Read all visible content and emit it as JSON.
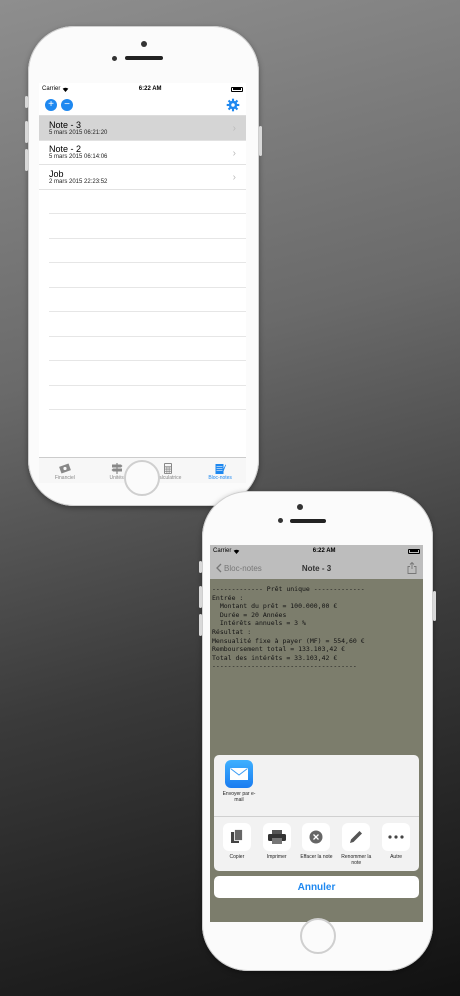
{
  "phone1": {
    "status": {
      "carrier": "Carrier",
      "time": "6:22 AM"
    },
    "toolbar": {
      "add_icon": "plus-icon",
      "remove_icon": "minus-icon",
      "settings_icon": "gear-icon"
    },
    "notes": [
      {
        "title": "Note - 3",
        "date": "5 mars 2015 06:21:20",
        "selected": true
      },
      {
        "title": "Note - 2",
        "date": "5 mars 2015 06:14:06",
        "selected": false
      },
      {
        "title": "Job",
        "date": "2 mars 2015 22:23:52",
        "selected": false
      }
    ],
    "tabs": [
      {
        "label": "Financiel",
        "icon": "money-icon"
      },
      {
        "label": "Unités",
        "icon": "signpost-icon"
      },
      {
        "label": "Calculatrice",
        "icon": "calculator-icon"
      },
      {
        "label": "Bloc-notes",
        "icon": "notepad-icon"
      }
    ],
    "accent": "#1e88f0"
  },
  "phone2": {
    "status": {
      "carrier": "Carrier",
      "time": "6:22 AM"
    },
    "nav": {
      "back_label": "Bloc-notes",
      "title": "Note - 3"
    },
    "note_text": "------------- Prêt unique -------------\nEntrée :\n  Montant du prêt = 100.000,00 €\n  Durée = 20 Années\n  Intérêts annuels = 3 %\nRésultat :\nMensualité fixe à payer (MF) = 554,60 €\nRemboursement total = 133.103,42 €\nTotal des intérêts = 33.103,42 €\n-------------------------------------",
    "share": {
      "mail_label": "Envoyer par e-mail",
      "actions": [
        {
          "label": "Copier",
          "icon": "copy-icon"
        },
        {
          "label": "Imprimer",
          "icon": "printer-icon"
        },
        {
          "label": "Effacer la note",
          "icon": "clear-icon"
        },
        {
          "label": "Renommer la note",
          "icon": "pencil-icon"
        },
        {
          "label": "Autre",
          "icon": "more-icon"
        }
      ],
      "cancel_label": "Annuler"
    }
  }
}
